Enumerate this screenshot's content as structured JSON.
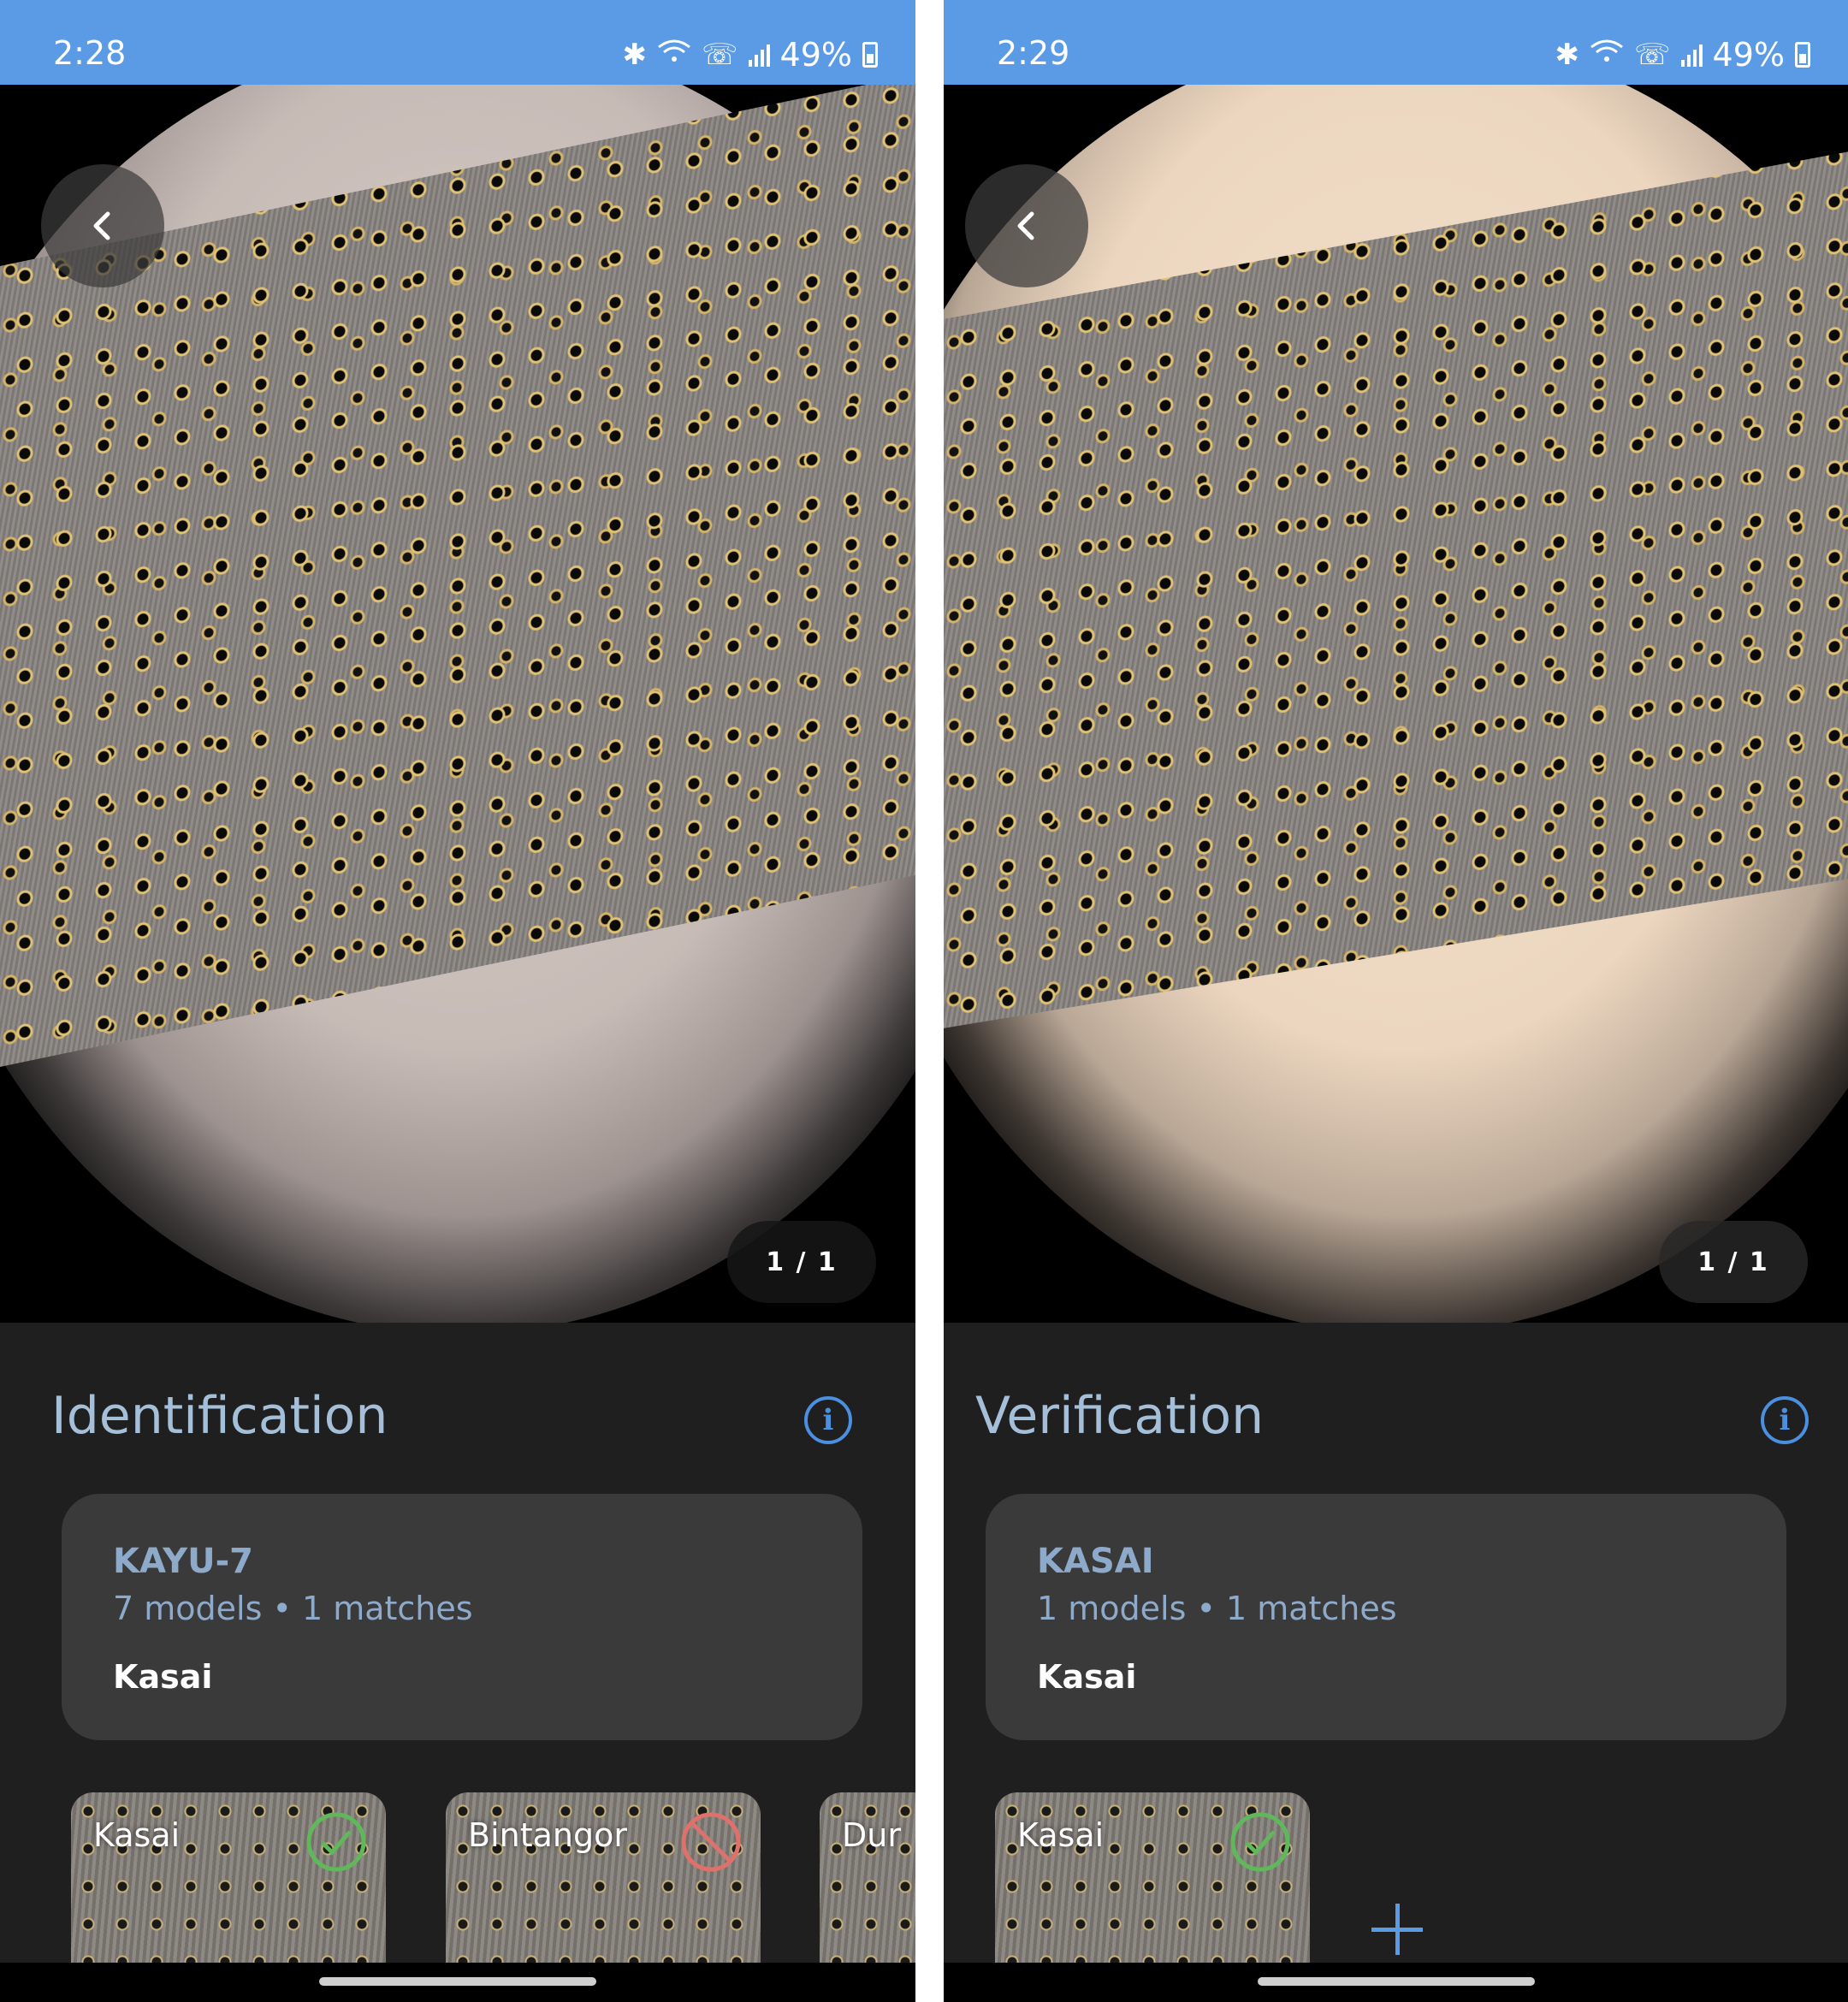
{
  "colors": {
    "status_bar": "#5b9be6",
    "accent": "#4b8fe0",
    "title": "#a5bfd9",
    "card": "#3a3a3a",
    "match": "#5fb85a",
    "reject": "#e0706a"
  },
  "screens": [
    {
      "status": {
        "time": "2:28",
        "battery": "49%"
      },
      "counter": "1 / 1",
      "title": "Identification",
      "card": {
        "model": "KAYU-7",
        "meta": "7 models • 1 matches",
        "result": "Kasai"
      },
      "thumbnails": [
        {
          "label": "Kasai",
          "status_icon": "check-circle-icon"
        },
        {
          "label": "Bintangor",
          "status_icon": "blocked-icon"
        },
        {
          "label": "Dur",
          "status_icon": ""
        }
      ]
    },
    {
      "status": {
        "time": "2:29",
        "battery": "49%"
      },
      "counter": "1 / 1",
      "title": "Verification",
      "card": {
        "model": "KASAI",
        "meta": "1 models • 1 matches",
        "result": "Kasai"
      },
      "thumbnails": [
        {
          "label": "Kasai",
          "status_icon": "check-circle-icon"
        }
      ]
    }
  ]
}
